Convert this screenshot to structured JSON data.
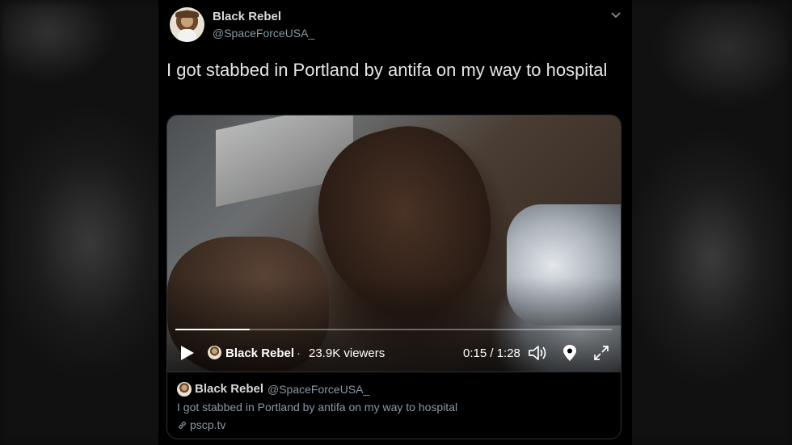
{
  "tweet": {
    "display_name": "Black Rebel",
    "handle": "@SpaceForceUSA_",
    "text": "I got stabbed in Portland by antifa on my way to hospital",
    "menu_icon": "chevron-down-icon"
  },
  "video": {
    "progress_fraction": 0.17,
    "broadcaster_name": "Black Rebel",
    "separator": "·",
    "viewers": "23.9K viewers",
    "time": "0:15 / 1:28",
    "icons": [
      "play-icon",
      "volume-icon",
      "location-icon",
      "fullscreen-icon"
    ]
  },
  "card": {
    "name": "Black Rebel",
    "handle": "@SpaceForceUSA_",
    "text": "I got stabbed in Portland by antifa on my way to hospital",
    "link": "pscp.tv",
    "link_icon": "link-icon"
  },
  "colors": {
    "background": "#000000",
    "secondary_text": "#8b98a5",
    "primary_text": "#e6e6e6"
  }
}
